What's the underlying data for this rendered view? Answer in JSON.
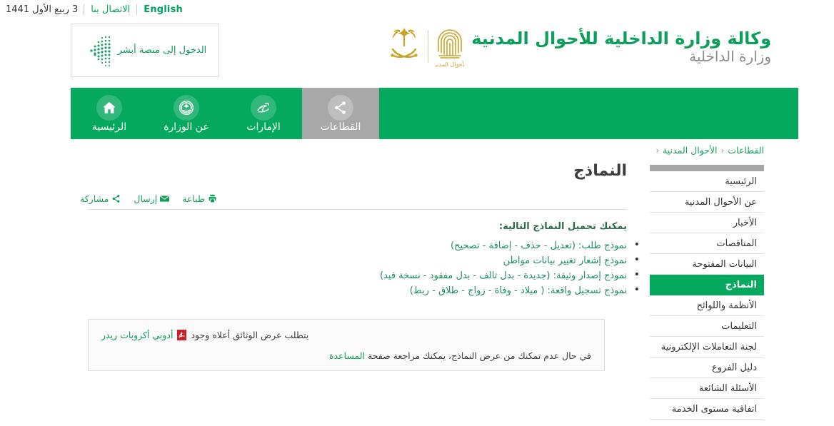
{
  "topbar": {
    "date": "3 ربيع الأول 1441",
    "contact_label": "الاتصال بنا",
    "english_label": "English"
  },
  "header": {
    "absher_label": "الدخول إلى منصة أبشر",
    "absher_icon": "absher-chevron-logo",
    "brand_title": "وكالة وزارة الداخلية للأحوال المدنية",
    "brand_sub": "وزارة الداخلية",
    "fingerprint_caption": "الأحوال المدنية",
    "emblem_icon": "saudi-emblem-palm-swords",
    "fingerprint_icon": "fingerprint-icon"
  },
  "nav": {
    "items": [
      {
        "label": "الرئيسية",
        "icon": "home-icon",
        "active": false
      },
      {
        "label": "عن الوزارة",
        "icon": "ministry-emblem-icon",
        "active": false
      },
      {
        "label": "الإمارات",
        "icon": "calligraphy-imarat-icon",
        "active": false
      },
      {
        "label": "القطاعات",
        "icon": "share-network-icon",
        "active": true
      }
    ]
  },
  "breadcrumb": {
    "items": [
      "القطاعات",
      "الأحوال المدنية"
    ],
    "separator": "‹"
  },
  "sidebar": {
    "items": [
      {
        "label": "الرئيسية",
        "active": false
      },
      {
        "label": "عن الأحوال المدنية",
        "active": false
      },
      {
        "label": "الأخبار",
        "active": false
      },
      {
        "label": "المناقصات",
        "active": false
      },
      {
        "label": "البيانات المفتوحة",
        "active": false
      },
      {
        "label": "النماذج",
        "active": true
      },
      {
        "label": "الأنظمة واللوائح",
        "active": false
      },
      {
        "label": "التعليمات",
        "active": false
      },
      {
        "label": "لجنة التعاملات الإلكترونية",
        "active": false
      },
      {
        "label": "دليل الفروع",
        "active": false
      },
      {
        "label": "الأسئلة الشائعة",
        "active": false
      },
      {
        "label": "اتفاقية مستوى الخدمة",
        "active": false
      }
    ]
  },
  "main": {
    "title": "النماذج",
    "toolbar": [
      {
        "label": "طباعة",
        "icon": "printer-icon"
      },
      {
        "label": "إرسال",
        "icon": "envelope-icon"
      },
      {
        "label": "مشاركة",
        "icon": "share-icon"
      }
    ],
    "lead": "يمكنك تحميل النماذج التالية:",
    "forms": [
      "نموذج طلب: (تعديل - حذف - إضافة - تصحيح)",
      "نموذج إشعار تغيير بيانات مواطن",
      "نموذج إصدار وثيقة: (جديدة - بدل تالف - بدل مفقود - نسخة قيد)",
      "نموذج تسجيل واقعة: ( ميلاد - وفاة - زواج - طلاق - ربط)"
    ],
    "notice": {
      "line1_text": "يتطلب عرض الوثائق أعلاه وجود",
      "line1_link": "أدوبي أكروبات ريدر",
      "pdf_icon": "pdf-icon",
      "line2_prefix": "في حال عدم تمكنك من عرض النماذج، يمكنك مراجعة صفحة",
      "line2_link": "المساعدة"
    }
  },
  "colors": {
    "brand_green": "#04a95d",
    "link_green": "#0f9d57",
    "active_gray": "#a8a8a8",
    "gold": "#c9a227",
    "pdf_red": "#cc2127"
  }
}
